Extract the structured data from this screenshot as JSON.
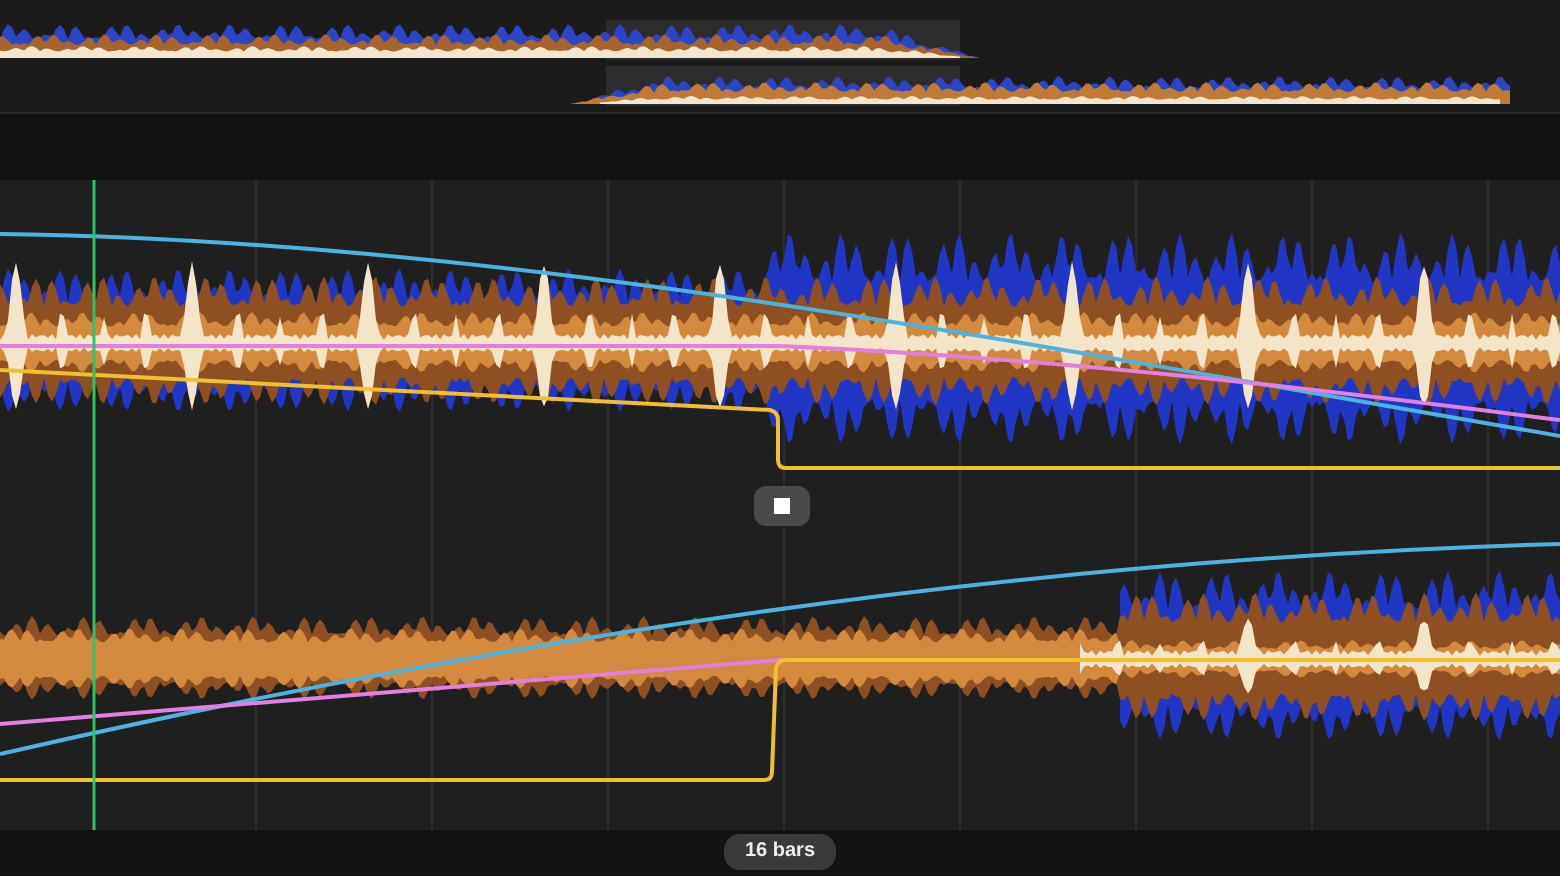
{
  "loop_length": "16 bars"
}
